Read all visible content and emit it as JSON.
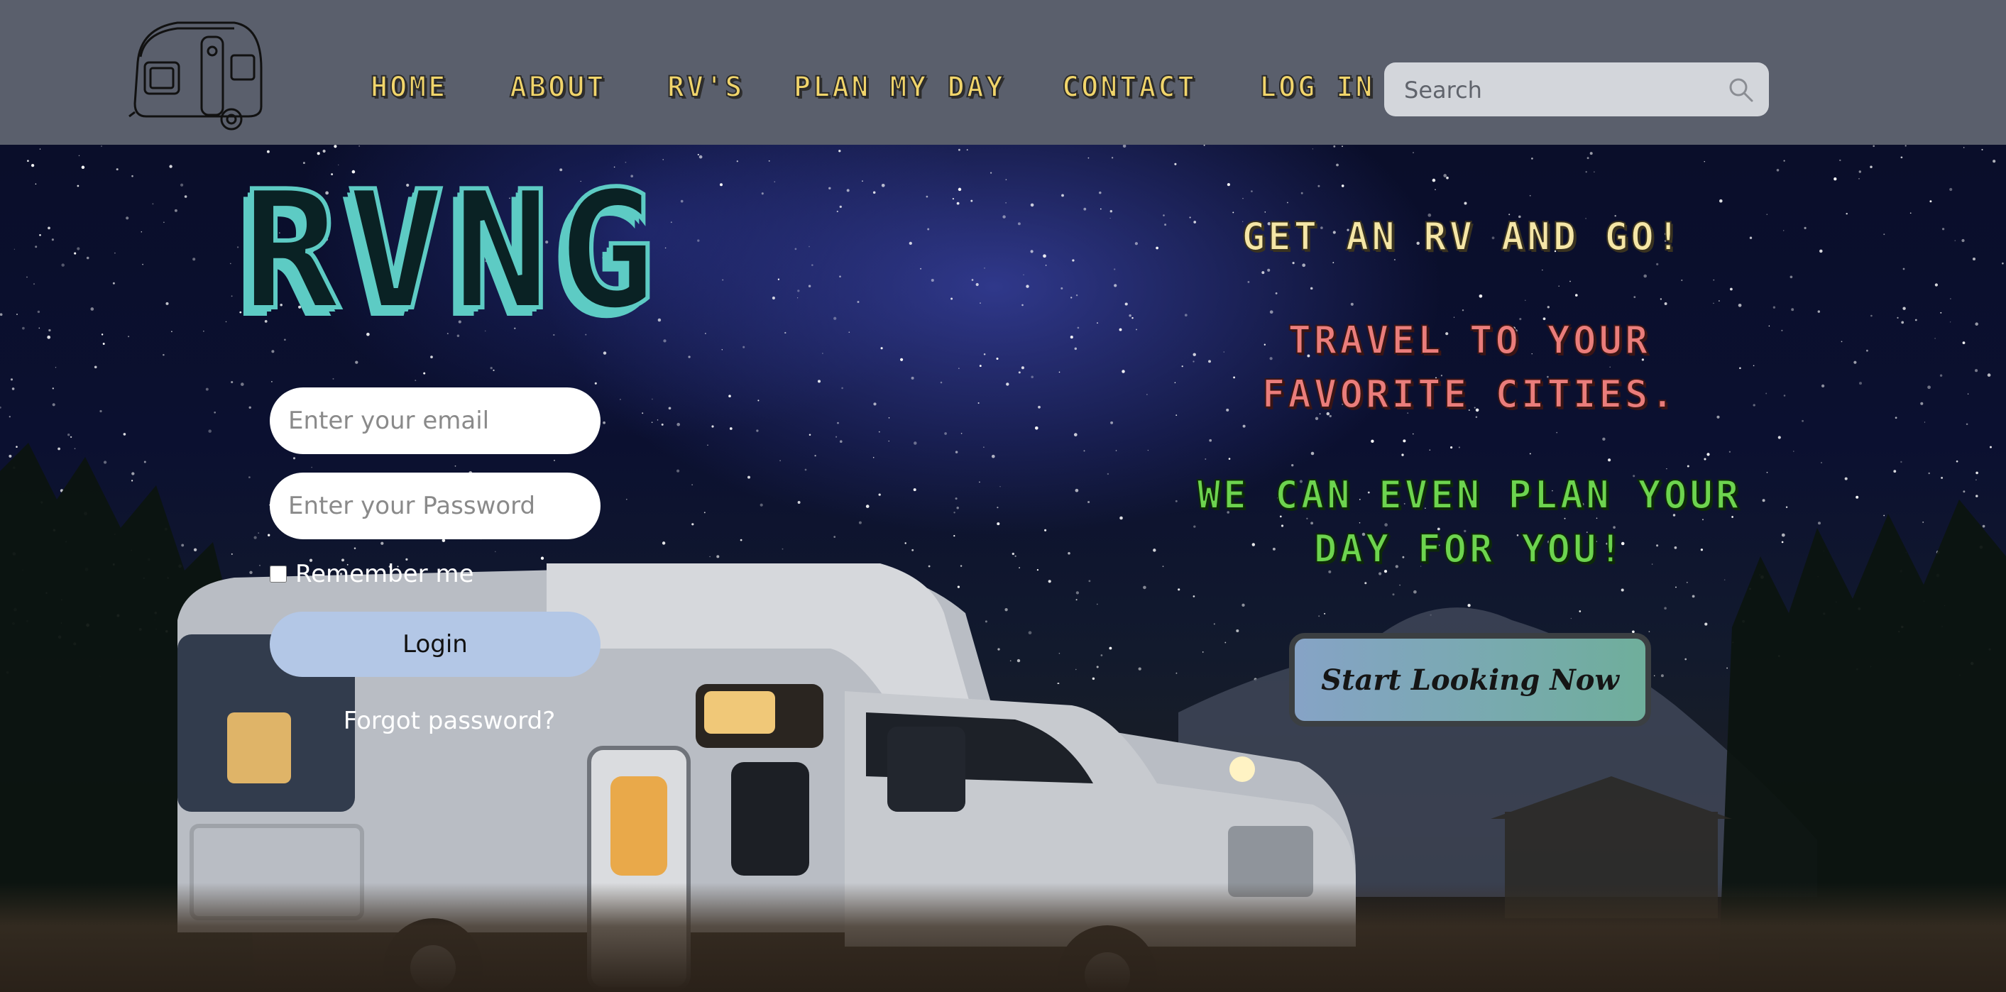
{
  "nav": {
    "logo_icon": "camper-trailer-logo-icon",
    "items": [
      {
        "label": "HOME"
      },
      {
        "label": "ABOUT"
      },
      {
        "label": "RV'S"
      },
      {
        "label": "PLAN MY DAY"
      },
      {
        "label": "CONTACT"
      },
      {
        "label": "LOG IN"
      }
    ],
    "search": {
      "placeholder": "Search",
      "icon": "search-icon"
    }
  },
  "hero": {
    "brand": "RVNG",
    "login": {
      "email_placeholder": "Enter your email",
      "password_placeholder": "Enter your Password",
      "remember_label": "Remember me",
      "login_label": "Login",
      "forgot_label": "Forgot password?"
    },
    "taglines": {
      "line1": "GET AN RV AND GO!",
      "line2": "TRAVEL TO YOUR FAVORITE CITIES.",
      "line3": "WE CAN EVEN PLAN YOUR DAY FOR YOU!"
    },
    "cta_label": "Start Looking Now",
    "background_image": "motorhome-under-starry-night-photo"
  },
  "colors": {
    "nav_bg": "#5a5f6c",
    "nav_text": "#f1d56b",
    "brand_teal": "#5dcbc4",
    "tagline_cream": "#f5e6a6",
    "tagline_coral": "#ea7d7b",
    "tagline_green": "#6dd44f",
    "login_button": "#b3c7e6",
    "search_bg": "#d3d6db"
  }
}
